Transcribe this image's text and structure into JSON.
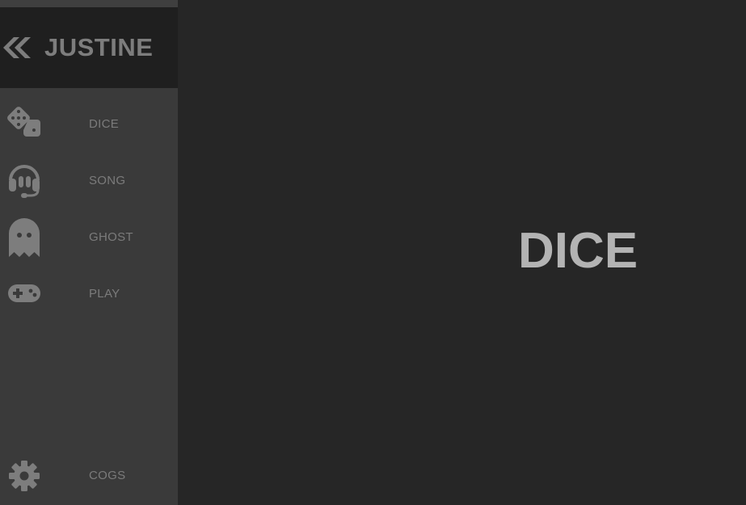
{
  "brand": {
    "title": "JUSTINE",
    "icon": "double-chevron-left-icon"
  },
  "nav": {
    "items": [
      {
        "label": "DICE",
        "icon": "dice-icon"
      },
      {
        "label": "SONG",
        "icon": "headset-icon"
      },
      {
        "label": "GHOST",
        "icon": "ghost-icon"
      },
      {
        "label": "PLAY",
        "icon": "gamepad-icon"
      }
    ],
    "footer": {
      "label": "COGS",
      "icon": "gear-icon"
    }
  },
  "main": {
    "title": "DICE"
  },
  "colors": {
    "sidebar": "#3a3a3a",
    "brand_bar": "#1f1f1f",
    "main_bg": "#262626",
    "icon": "#7d7d7d",
    "title": "#b3b3b3"
  }
}
